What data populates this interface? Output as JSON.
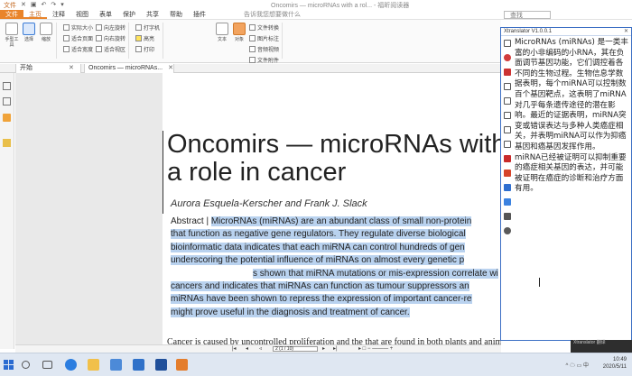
{
  "window": {
    "title": "Oncomirs — microRNAs with a rol... - 福昕阅读器",
    "qat": [
      "文件",
      "✕",
      "▣",
      "↶",
      "↷",
      "▾"
    ]
  },
  "menu": {
    "tabs": [
      "文件",
      "主页",
      "注释",
      "视图",
      "表单",
      "保护",
      "共享",
      "帮助",
      "插件"
    ],
    "search_placeholder": "告诉我您想要做什么",
    "right_search": "查找"
  },
  "ribbon": {
    "tools": [
      {
        "label": "手型工具"
      },
      {
        "label": "选择"
      },
      {
        "label": "缩放"
      }
    ],
    "view_col1": [
      "实际大小",
      "适合页面",
      "适合宽度"
    ],
    "view_col2": [
      "向左旋转",
      "向右旋转",
      "适合视区"
    ],
    "edit_col": [
      "打字机",
      "高亮",
      "打印"
    ],
    "right_tools": [
      {
        "label": "文本"
      },
      {
        "label": "对象"
      }
    ],
    "right_col": [
      "文件转换",
      "图片标注",
      "音频视频",
      "文件附件"
    ]
  },
  "doc_tabs": [
    {
      "label": "开始",
      "close": "✕"
    },
    {
      "label": "Oncomirs — microRNAs...",
      "close": "✕"
    }
  ],
  "document": {
    "title_line1": "Oncomirs — microRNAs with",
    "title_line2": "a role in cancer",
    "authors": "Aurora Esquela-Kerscher and Frank J. Slack",
    "abstract_label": "Abstract | ",
    "abstract_lines": [
      "MicroRNAs (miRNAs) are an abundant class of small non-protein",
      "that function as negative gene regulators. They regulate diverse biological",
      "bioinformatic data indicates that each miRNA can control hundreds of gen",
      "underscoring the potential influence of miRNAs on almost every genetic p",
      "s shown that miRNA mutations or mis-expression correlate wi",
      "cancers and indicates that miRNAs can function as tumour suppressors an",
      "miRNAs have been shown to repress the expression of important cancer-re",
      "might prove useful in the diagnosis and treatment of cancer."
    ],
    "body_line": "Cancer is caused by uncontrolled proliferation and the     that are found in both plants and animals. They were"
  },
  "nav": {
    "page_display": "2 (1 / 10)",
    "zoom": "▸ □ − ——— +"
  },
  "translator": {
    "title": "Xtranslator V1.0.0.1",
    "close": "✕",
    "paragraphs": [
      "MicroRNAs (miRNAs) 是一类丰富的小非编码的小RNA，其在负面调节基因功能，它们调控着各不同的生物过程。生物信息学数据表明，每个miRNA可以控制数百个基因靶点，这表明了miRNA对几乎每条遗传途径的潜在影响。最近的证据表明，miRNA突变或错误表达与多种人类癌症相关，并表明miRNA可以作为抑癌基因和癌基因发挥作用。",
      "miRNA已经被证明可以抑制重要的癌症相关基因的表达，并可能被证明在癌症的诊断和治疗方面有用。"
    ],
    "footer": "Xtranslator 翻译"
  },
  "taskbar": {
    "time": "10:49",
    "date": "2020/5/11",
    "tray": "^ ☁ ▭ 中"
  },
  "colors": {
    "accent_orange": "#e9842a",
    "selection_blue": "#b9d2ef",
    "translator_border": "#3c6fc4",
    "taskbar": "#dfe7f2"
  }
}
